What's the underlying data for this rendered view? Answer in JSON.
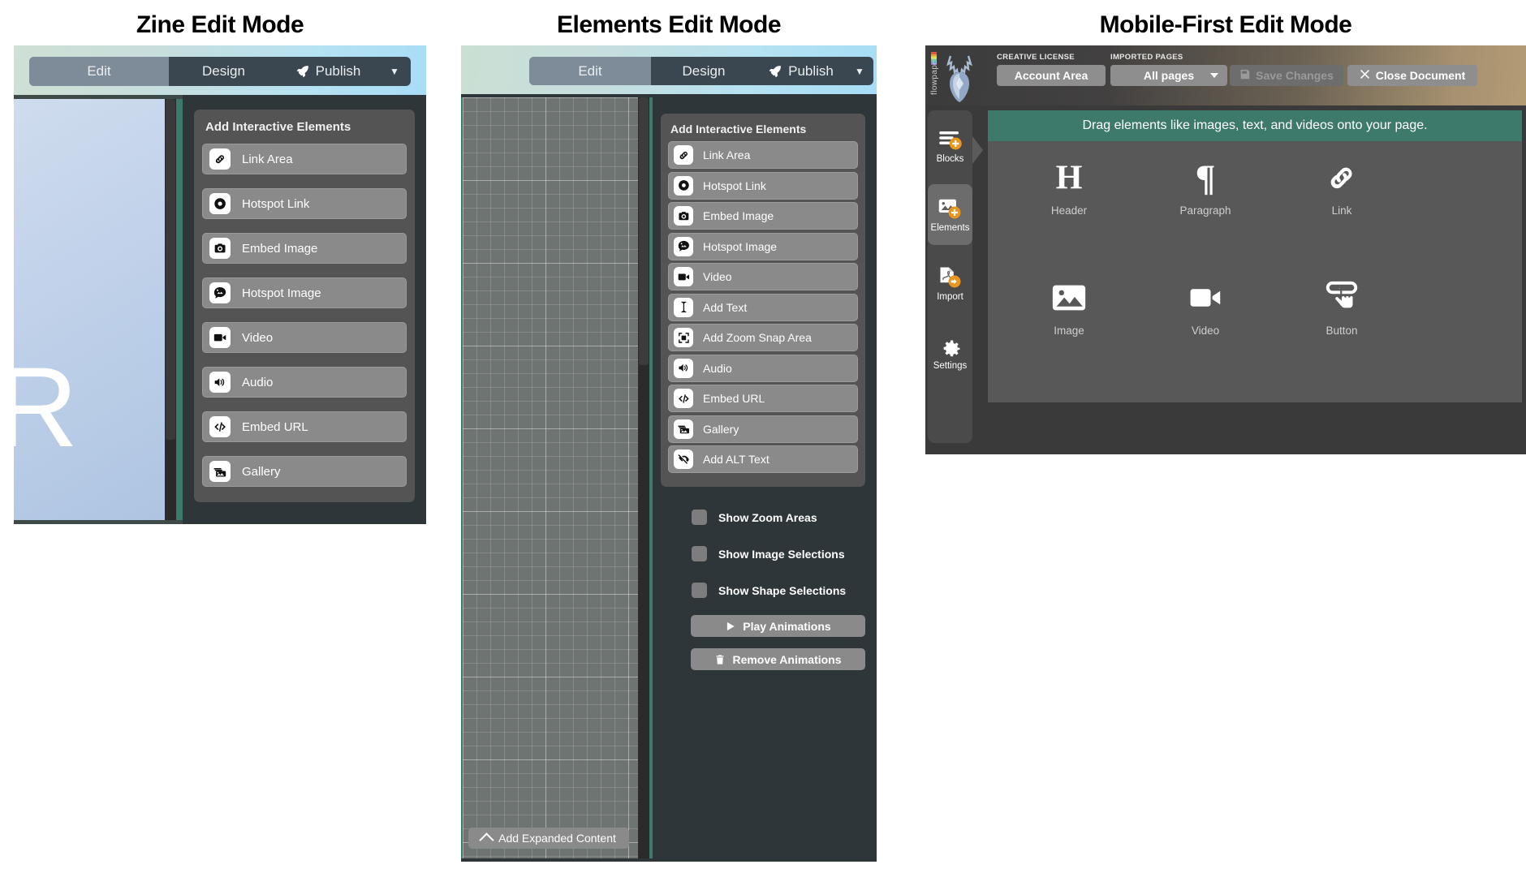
{
  "panels": [
    {
      "title": "Zine Edit Mode",
      "toolbar": {
        "edit_label": "Edit",
        "design_label": "Design",
        "publish_label": "Publish",
        "publish_icon": "rocket-icon",
        "caret_icon": "chevron-down-icon"
      },
      "page_letter": "R",
      "add_panel": {
        "heading": "Add Interactive Elements",
        "items": [
          {
            "label": "Link Area",
            "icon": "link-icon"
          },
          {
            "label": "Hotspot Link",
            "icon": "hotspot-dot-icon"
          },
          {
            "label": "Embed Image",
            "icon": "camera-icon"
          },
          {
            "label": "Hotspot Image",
            "icon": "speech-image-icon"
          },
          {
            "label": "Video",
            "icon": "video-camera-icon"
          },
          {
            "label": "Audio",
            "icon": "speaker-icon"
          },
          {
            "label": "Embed URL",
            "icon": "code-icon"
          },
          {
            "label": "Gallery",
            "icon": "gallery-icon"
          }
        ]
      }
    },
    {
      "title": "Elements Edit Mode",
      "toolbar": {
        "edit_label": "Edit",
        "design_label": "Design",
        "publish_label": "Publish",
        "publish_icon": "rocket-icon",
        "caret_icon": "chevron-down-icon"
      },
      "canvas": {
        "expand_label": "Add Expanded Content",
        "expand_icon": "chevron-up-icon"
      },
      "add_panel": {
        "heading": "Add Interactive Elements",
        "items": [
          {
            "label": "Link Area",
            "icon": "link-icon"
          },
          {
            "label": "Hotspot Link",
            "icon": "hotspot-dot-icon"
          },
          {
            "label": "Embed Image",
            "icon": "camera-icon"
          },
          {
            "label": "Hotspot Image",
            "icon": "speech-image-icon"
          },
          {
            "label": "Video",
            "icon": "video-camera-icon"
          },
          {
            "label": "Add Text",
            "icon": "text-cursor-icon"
          },
          {
            "label": "Add Zoom Snap Area",
            "icon": "zoom-snap-icon"
          },
          {
            "label": "Audio",
            "icon": "speaker-icon"
          },
          {
            "label": "Embed URL",
            "icon": "code-icon"
          },
          {
            "label": "Gallery",
            "icon": "gallery-icon"
          },
          {
            "label": "Add ALT Text",
            "icon": "eye-slash-icon"
          }
        ]
      },
      "toggles": [
        {
          "label": "Show Zoom Areas",
          "checked": false
        },
        {
          "label": "Show Image Selections",
          "checked": false
        },
        {
          "label": "Show Shape Selections",
          "checked": false
        }
      ],
      "actions": [
        {
          "label": "Play Animations",
          "icon": "play-icon"
        },
        {
          "label": "Remove Animations",
          "icon": "trash-icon"
        }
      ]
    },
    {
      "title": "Mobile-First Edit Mode",
      "brand": "flowpaper",
      "header": {
        "license_caption": "CREATIVE LICENSE",
        "pages_caption": "IMPORTED PAGES",
        "account_label": "Account Area",
        "pages_value": "All pages",
        "save_label": "Save Changes",
        "save_icon": "save-disk-icon",
        "close_label": "Close Document",
        "close_icon": "close-x-icon"
      },
      "sidebar": [
        {
          "label": "Blocks",
          "icon": "blocks-add-icon",
          "active": false
        },
        {
          "label": "Elements",
          "icon": "image-add-icon",
          "active": true
        },
        {
          "label": "Import",
          "icon": "pdf-import-icon",
          "active": false
        },
        {
          "label": "Settings",
          "icon": "gear-icon",
          "active": false
        }
      ],
      "banner": "Drag elements like images, text, and videos onto your page.",
      "elements": [
        {
          "label": "Header",
          "icon": "heading-h-icon"
        },
        {
          "label": "Paragraph",
          "icon": "pilcrow-icon"
        },
        {
          "label": "Link",
          "icon": "link-icon"
        },
        {
          "label": "Image",
          "icon": "picture-icon"
        },
        {
          "label": "Video",
          "icon": "video-camera-icon"
        },
        {
          "label": "Button",
          "icon": "tap-button-icon"
        }
      ]
    }
  ],
  "colors": {
    "accent_teal": "#3d7a6c",
    "accent_orange": "#e8961e",
    "panel_dark": "#2e363a",
    "button_gray": "#8a8a8a"
  }
}
